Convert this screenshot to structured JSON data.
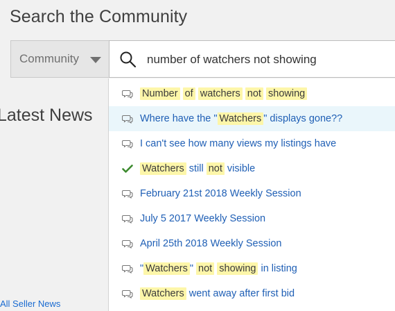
{
  "heading": "Search the Community",
  "scope": {
    "label": "Community"
  },
  "search": {
    "value": "number of watchers not showing"
  },
  "news": {
    "title": "Latest News",
    "link": "All Seller News"
  },
  "suggestions": [
    {
      "icon": "chat-bubbles-icon",
      "parts": [
        {
          "t": "Number",
          "h": true
        },
        {
          "t": " "
        },
        {
          "t": "of",
          "h": true
        },
        {
          "t": " "
        },
        {
          "t": "watchers",
          "h": true
        },
        {
          "t": " "
        },
        {
          "t": "not",
          "h": true
        },
        {
          "t": " "
        },
        {
          "t": "showing",
          "h": true
        }
      ]
    },
    {
      "icon": "chat-bubbles-icon",
      "hover": true,
      "parts": [
        {
          "t": "Where have the \""
        },
        {
          "t": "Watchers",
          "h": true
        },
        {
          "t": "\" displays gone??"
        }
      ]
    },
    {
      "icon": "chat-bubbles-icon",
      "parts": [
        {
          "t": "I can't see how many views my listings have"
        }
      ]
    },
    {
      "icon": "checkmark-icon",
      "parts": [
        {
          "t": "Watchers",
          "h": true
        },
        {
          "t": " still "
        },
        {
          "t": "not",
          "h": true
        },
        {
          "t": " visible"
        }
      ]
    },
    {
      "icon": "chat-bubbles-icon",
      "parts": [
        {
          "t": "February 21st 2018 Weekly Session"
        }
      ]
    },
    {
      "icon": "chat-bubbles-icon",
      "parts": [
        {
          "t": "July 5 2017 Weekly Session"
        }
      ]
    },
    {
      "icon": "chat-bubbles-icon",
      "parts": [
        {
          "t": "April 25th 2018 Weekly Session"
        }
      ]
    },
    {
      "icon": "chat-bubbles-icon",
      "parts": [
        {
          "t": "\""
        },
        {
          "t": "Watchers",
          "h": true
        },
        {
          "t": "\" "
        },
        {
          "t": "not",
          "h": true
        },
        {
          "t": " "
        },
        {
          "t": "showing",
          "h": true
        },
        {
          "t": " in listing"
        }
      ]
    },
    {
      "icon": "chat-bubbles-icon",
      "parts": [
        {
          "t": "Watchers",
          "h": true
        },
        {
          "t": " went away after first bid"
        }
      ]
    }
  ],
  "colors": {
    "link": "#1f5fb5",
    "highlight": "#fdf6a9",
    "hover": "#eaf6fb",
    "check": "#3c8a2e"
  }
}
